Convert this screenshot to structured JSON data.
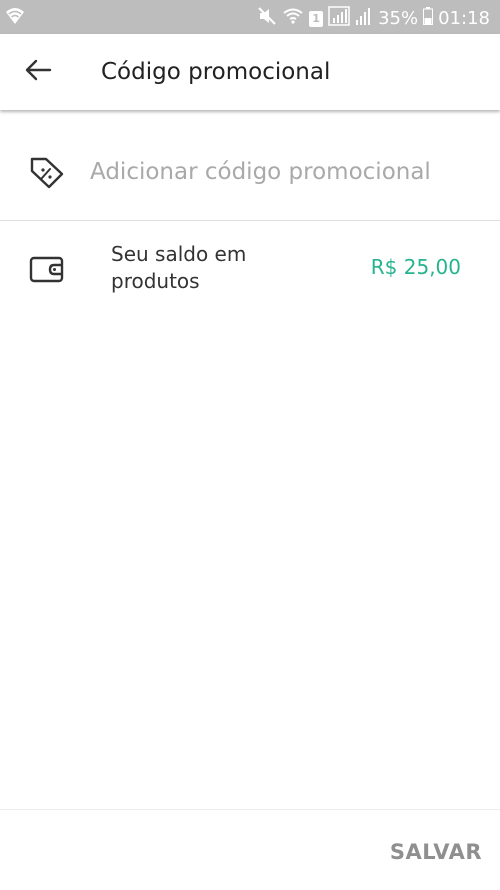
{
  "status_bar": {
    "battery_percent": "35%",
    "time": "01:18",
    "sim_badge": "1",
    "icons": [
      "wifi-icon",
      "mute-icon",
      "wifi-icon",
      "sim-icon",
      "signal-icon",
      "signal-icon",
      "battery-icon"
    ]
  },
  "app_bar": {
    "back_icon": "arrow-left-icon",
    "title": "Código promocional"
  },
  "promo": {
    "icon": "discount-tag-icon",
    "placeholder": "Adicionar código promocional"
  },
  "balance": {
    "icon": "wallet-icon",
    "label": "Seu saldo em produtos",
    "amount": "R$ 25,00",
    "amount_color": "#25b48f"
  },
  "footer": {
    "save_label": "SALVAR"
  }
}
